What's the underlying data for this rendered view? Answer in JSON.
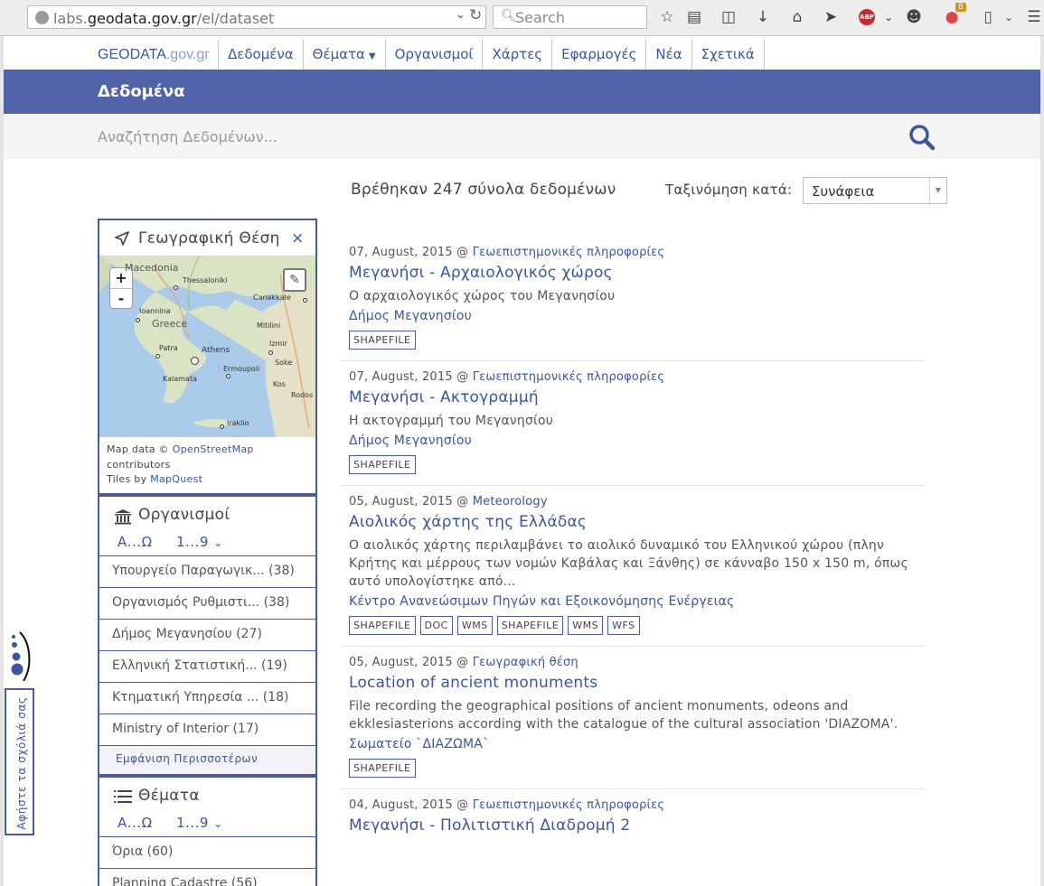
{
  "browser": {
    "url_prefix": "labs.",
    "url_host": "geodata.gov.gr",
    "url_path": "/el/dataset",
    "search_placeholder": "Search",
    "badge_count": "8",
    "abp_label": "ABP"
  },
  "nav": {
    "brand_main": "GEODATA",
    "brand_suffix": ".gov.gr",
    "items": [
      "Δεδομένα",
      "Θέματα",
      "Οργανισμοί",
      "Χάρτες",
      "Εφαρμογές",
      "Νέα",
      "Σχετικά"
    ]
  },
  "banner": {
    "title": "Δεδομένα"
  },
  "search": {
    "placeholder": "Αναζήτηση Δεδομένων..."
  },
  "results_header": {
    "count_text": "Βρέθηκαν 247 σύνολα δεδομένων",
    "sort_label": "Ταξινόμηση κατά:",
    "sort_value": "Συνάφεια"
  },
  "geo": {
    "title": "Γεωγραφική Θέση",
    "close": "×",
    "zoom_in": "+",
    "zoom_out": "-",
    "cities": [
      "Macedonia",
      "Thessaloniki",
      "Ioannina",
      "Greece",
      "Patra",
      "Athens",
      "Kalamata",
      "Ermoupoli",
      "Canakkale",
      "Mitilini",
      "Izmir",
      "Soke",
      "Kos",
      "Rodos",
      "Iraklio"
    ],
    "attr_prefix": "Map data ©",
    "attr_osm": "OpenStreetMap",
    "attr_contrib": "contributors",
    "attr_tiles": "Tiles by",
    "attr_mq": "MapQuest"
  },
  "orgs": {
    "title": "Οργανισμοί",
    "sort_alpha": "Α...Ω",
    "sort_num": "1...9",
    "items": [
      "Υπουργείο Παραγωγικ... (38)",
      "Οργανισμός Ρυθμιστι... (38)",
      "Δήμος Μεγανησίου (27)",
      "Ελληνική Στατιστική... (19)",
      "Κτηματική Υπηρεσία ... (18)",
      "Ministry of Interior (17)"
    ],
    "show_more": "Εμφάνιση Περισσοτέρων"
  },
  "topics": {
    "title": "Θέματα",
    "sort_alpha": "Α...Ω",
    "sort_num": "1...9",
    "items": [
      "Όρια (60)",
      "Planning Cadastre (56)"
    ]
  },
  "feedback": {
    "label": "Αφήστε τα σχόλιά σας"
  },
  "datasets": [
    {
      "date": "07, August, 2015 @",
      "group": "Γεωεπιστημονικές πληροφορίες",
      "title": "Μεγανήσι - Αρχαιολογικός χώρος",
      "desc": "Ο αρχαιολογικός χώρος του Μεγανησίου",
      "org": "Δήμος Μεγανησίου",
      "tags": [
        "SHAPEFILE"
      ]
    },
    {
      "date": "07, August, 2015 @",
      "group": "Γεωεπιστημονικές πληροφορίες",
      "title": "Μεγανήσι - Ακτογραμμή",
      "desc": "Η ακτογραμμή του Μεγανησίου",
      "org": "Δήμος Μεγανησίου",
      "tags": [
        "SHAPEFILE"
      ]
    },
    {
      "date": "05, August, 2015 @",
      "group": "Meteorology",
      "title": "Αιολικός χάρτης της Ελλάδας",
      "desc": "Ο αιολικός χάρτης περιλαμβάνει το αιολικό δυναμικό του Ελληνικού χώρου (πλην Κρήτης και μέρρους των νομών Καβάλας και Ξάνθης) σε κάνναβο 150 x 150 m, όπως αυτό υπολογίστηκε από...",
      "org": "Κέντρο Ανανεώσιμων Πηγών και Εξοικονόμησης Ενέργειας",
      "tags": [
        "SHAPEFILE",
        "DOC",
        "WMS",
        "SHAPEFILE",
        "WMS",
        "WFS"
      ]
    },
    {
      "date": "05, August, 2015 @",
      "group": "Γεωγραφική θέση",
      "title": "Location of ancient monuments",
      "desc": "File recording the geographical positions of ancient monuments, odeons and ekklesiasterions according with the catalogue of the cultural association 'DIAZOMA'.",
      "org": "Σωματείο `ΔΙΑΖΩΜΑ`",
      "tags": [
        "SHAPEFILE"
      ]
    },
    {
      "date": "04, August, 2015 @",
      "group": "Γεωεπιστημονικές πληροφορίες",
      "title": "Μεγανήσι - Πολιτιστική Διαδρομή 2",
      "desc": "",
      "org": "",
      "tags": []
    }
  ],
  "colors": {
    "brand": "#3a56a3",
    "banner": "#5062a8",
    "border": "#4a5ba0"
  }
}
